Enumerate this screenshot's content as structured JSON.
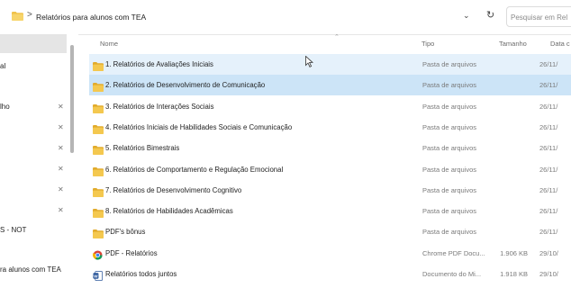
{
  "address": {
    "separator": ">",
    "path": "Relatórios para alunos com TEA",
    "search_placeholder": "Pesquisar em Rel"
  },
  "sidebar": {
    "items": [
      {
        "label": "al",
        "pinned": false
      },
      {
        "label": "lho",
        "pinned": true
      },
      {
        "label": "",
        "pinned": true
      },
      {
        "label": "",
        "pinned": true
      },
      {
        "label": "",
        "pinned": true
      },
      {
        "label": "",
        "pinned": true
      },
      {
        "label": "S - NOT",
        "pinned": false
      },
      {
        "label": "ra alunos com TEA",
        "pinned": false
      }
    ],
    "pin_glyph": "📌"
  },
  "columns": {
    "name": "Nome",
    "type": "Tipo",
    "size": "Tamanho",
    "date": "Data c"
  },
  "files": [
    {
      "name": "1. Relatórios de Avaliações Iniciais",
      "type": "Pasta de arquivos",
      "size": "",
      "date": "26/11/",
      "icon": "folder-icon",
      "state": "hover"
    },
    {
      "name": "2. Relatórios de Desenvolvimento de Comunicação",
      "type": "Pasta de arquivos",
      "size": "",
      "date": "26/11/",
      "icon": "folder-icon",
      "state": "selected"
    },
    {
      "name": "3. Relatórios de Interações Sociais",
      "type": "Pasta de arquivos",
      "size": "",
      "date": "26/11/",
      "icon": "folder-icon",
      "state": ""
    },
    {
      "name": "4. Relatórios Iniciais de Habilidades Sociais e Comunicação",
      "type": "Pasta de arquivos",
      "size": "",
      "date": "26/11/",
      "icon": "folder-icon",
      "state": ""
    },
    {
      "name": "5. Relatórios Bimestrais",
      "type": "Pasta de arquivos",
      "size": "",
      "date": "26/11/",
      "icon": "folder-icon",
      "state": ""
    },
    {
      "name": "6. Relatórios de Comportamento e Regulação Emocional",
      "type": "Pasta de arquivos",
      "size": "",
      "date": "26/11/",
      "icon": "folder-icon",
      "state": ""
    },
    {
      "name": "7. Relatórios de Desenvolvimento Cognitivo",
      "type": "Pasta de arquivos",
      "size": "",
      "date": "26/11/",
      "icon": "folder-icon",
      "state": ""
    },
    {
      "name": "8. Relatórios de Habilidades Acadêmicas",
      "type": "Pasta de arquivos",
      "size": "",
      "date": "26/11/",
      "icon": "folder-icon",
      "state": ""
    },
    {
      "name": "PDF's bônus",
      "type": "Pasta de arquivos",
      "size": "",
      "date": "26/11/",
      "icon": "folder-icon",
      "state": ""
    },
    {
      "name": "PDF - Relatórios",
      "type": "Chrome PDF Docu...",
      "size": "1.906 KB",
      "date": "29/10/",
      "icon": "chrome-pdf-icon",
      "state": ""
    },
    {
      "name": "Relatórios todos juntos",
      "type": "Documento do Mi...",
      "size": "1.918 KB",
      "date": "29/10/",
      "icon": "word-doc-icon",
      "state": ""
    }
  ],
  "colors": {
    "folder": "#f0c24a",
    "hover_row": "#e5f1fb",
    "selected_row": "#cce4f7"
  }
}
